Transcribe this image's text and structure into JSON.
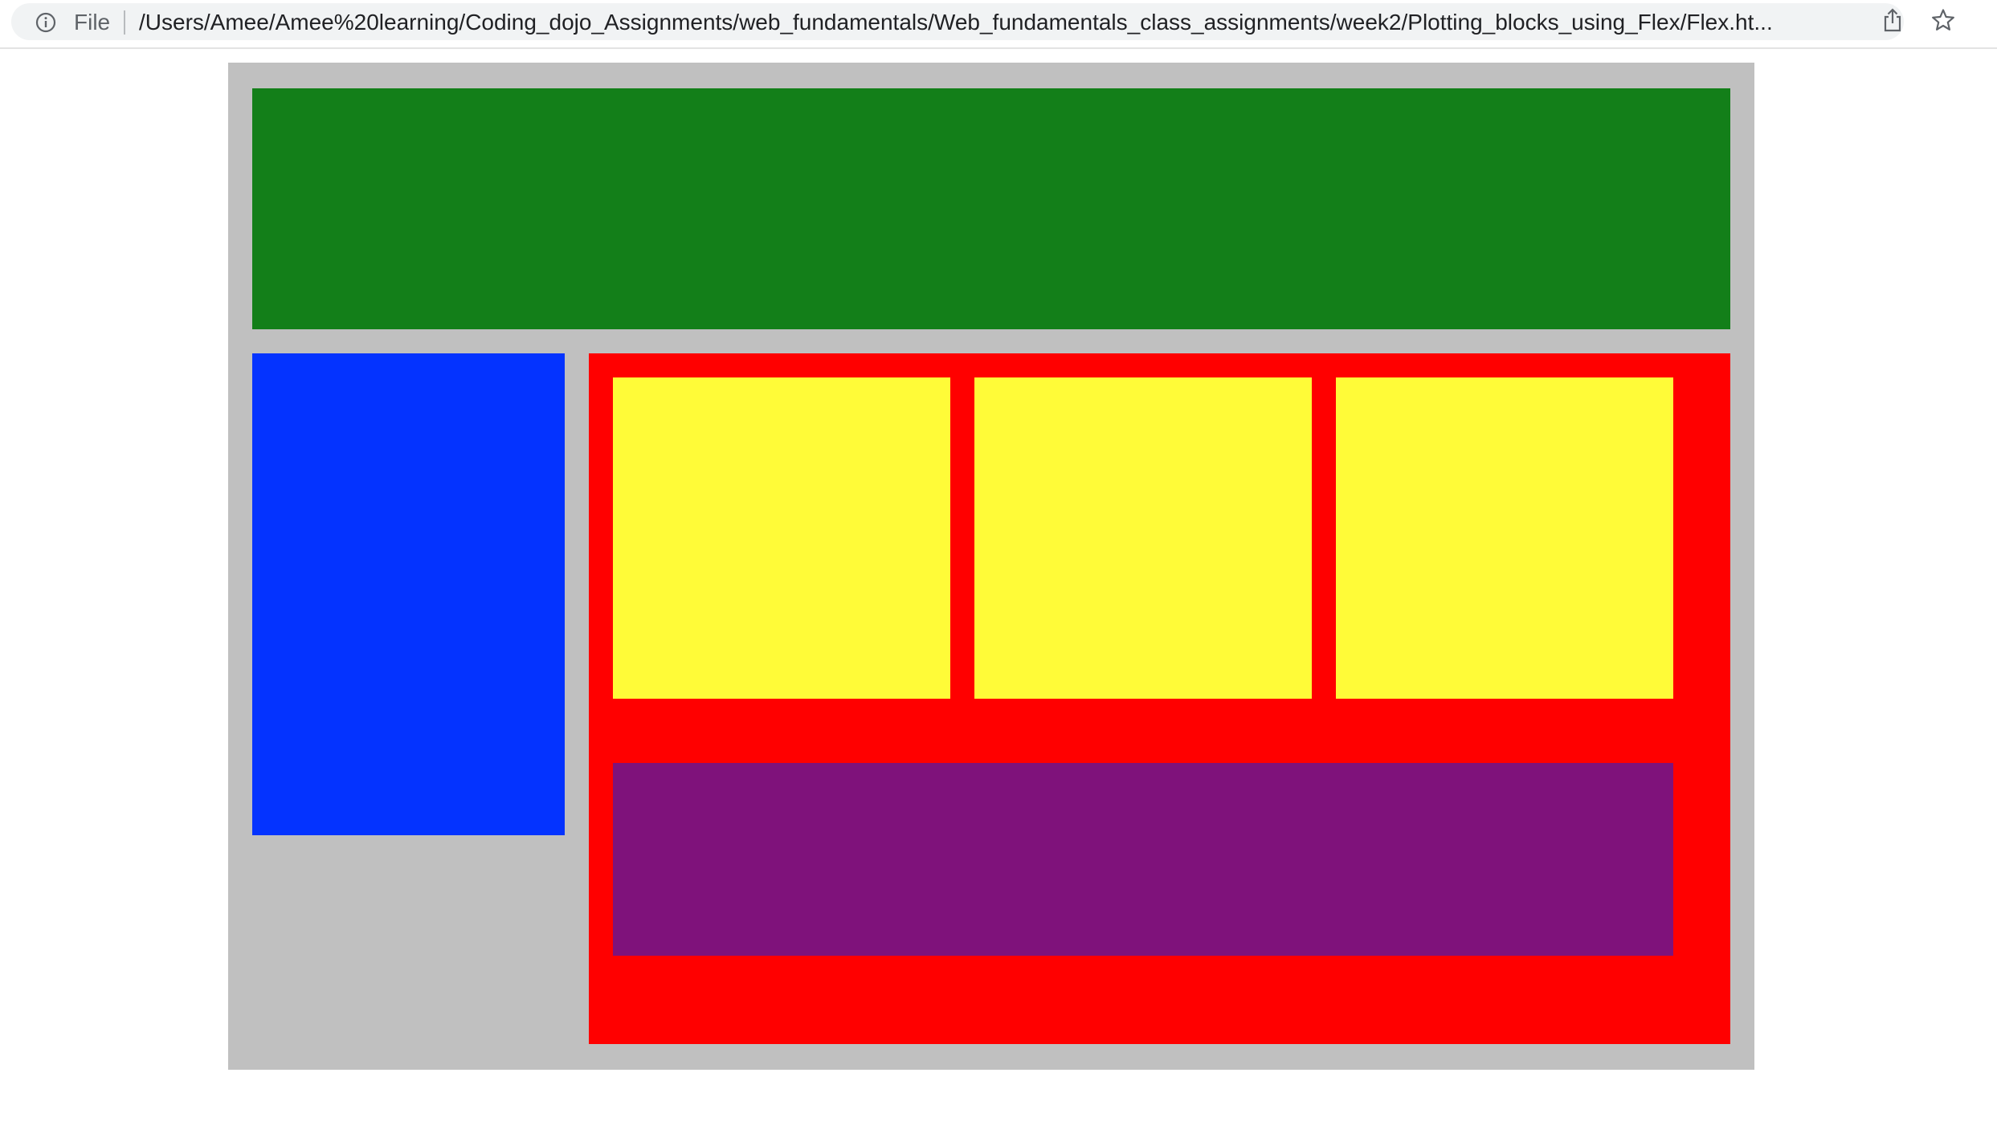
{
  "browser": {
    "scheme_label": "File",
    "url": "/Users/Amee/Amee%20learning/Coding_dojo_Assignments/web_fundamentals/Web_fundamentals_class_assignments/week2/Plotting_blocks_using_Flex/Flex.ht...",
    "icons": [
      "info-icon",
      "share-icon",
      "star-icon"
    ]
  },
  "page": {
    "colors": {
      "wrapper": "#c0c0c0",
      "header": "#137f19",
      "sidebar": "#0433ff",
      "main": "#ff0000",
      "yellow_blocks": "#fffb38",
      "purple_block": "#7f127b"
    }
  }
}
